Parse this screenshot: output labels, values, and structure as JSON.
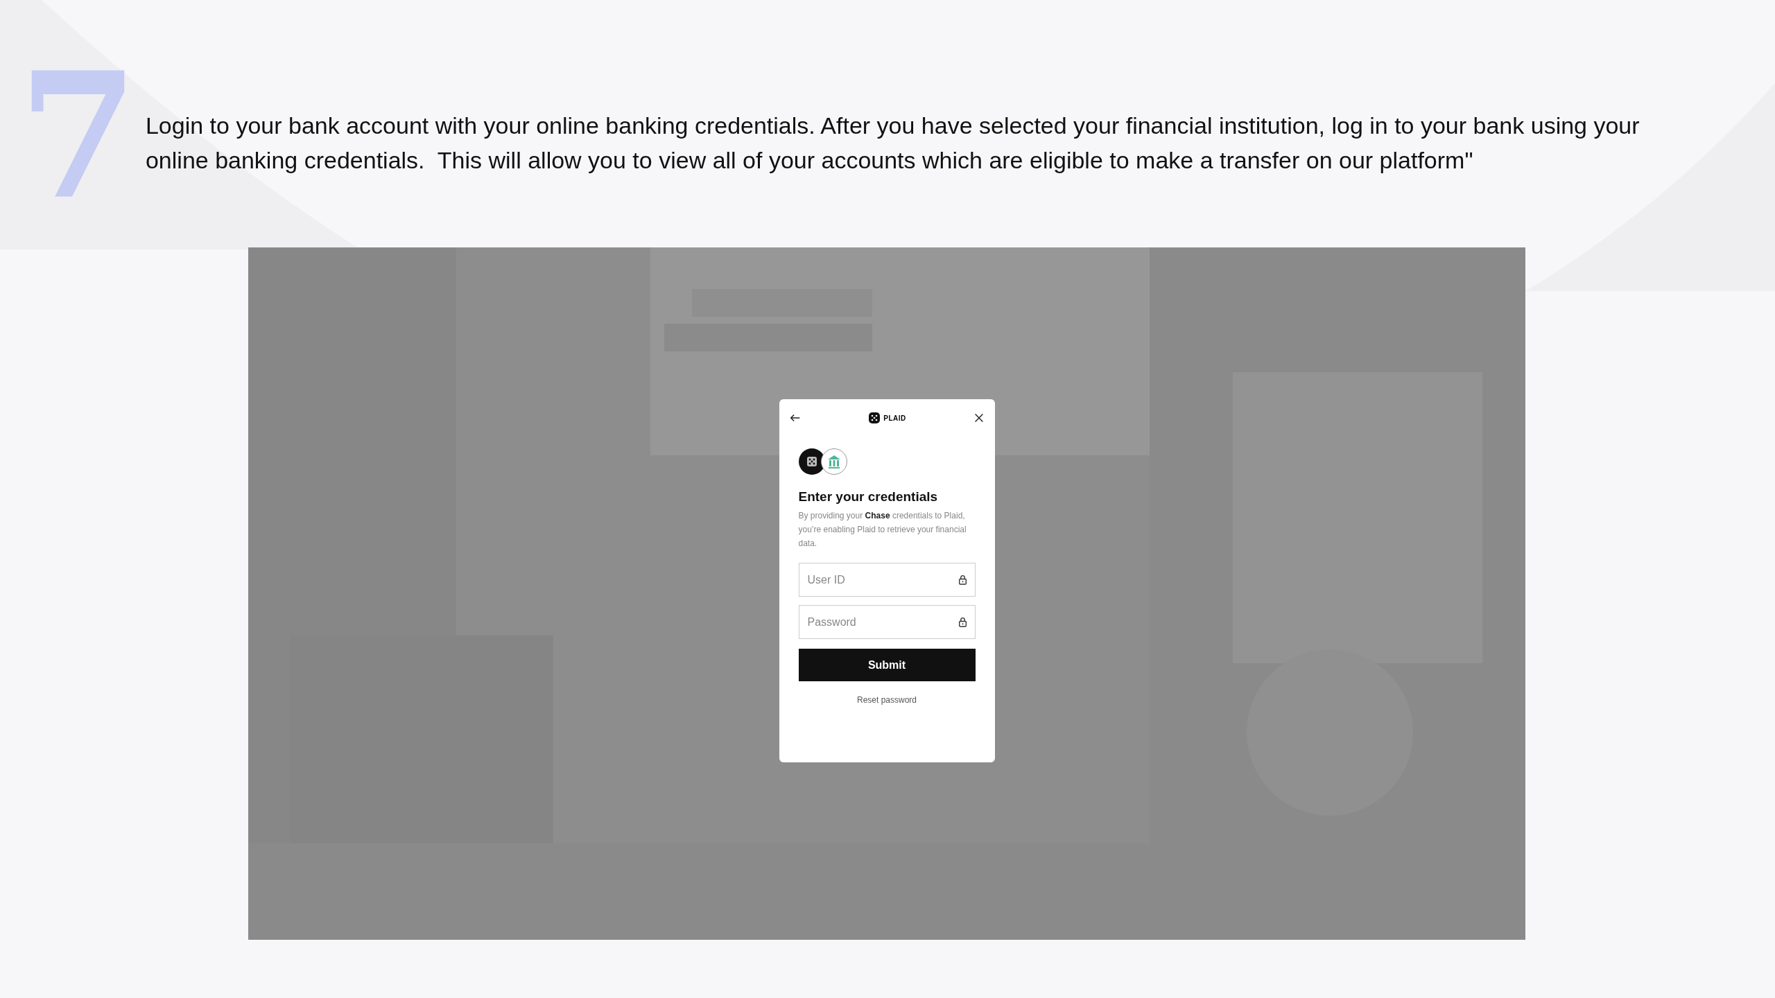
{
  "slide": {
    "step_number": "7",
    "instruction": "Login to your bank account with your online banking credentials. After you have selected your financial institution, log in to your bank using your online banking credentials.  This will allow you to view all of your accounts which are eligible to make a transfer on our platform\""
  },
  "screenshot": {
    "modal": {
      "brand": "PLAID",
      "title": "Enter your credentials",
      "description": "By providing your **Chase** credentials to Plaid, you’re enabling Plaid to retrieve your financial data.",
      "fields": [
        {
          "placeholder": "User ID"
        },
        {
          "placeholder": "Password"
        }
      ],
      "submit_button": "Submit",
      "reset_link": "Reset password"
    }
  }
}
